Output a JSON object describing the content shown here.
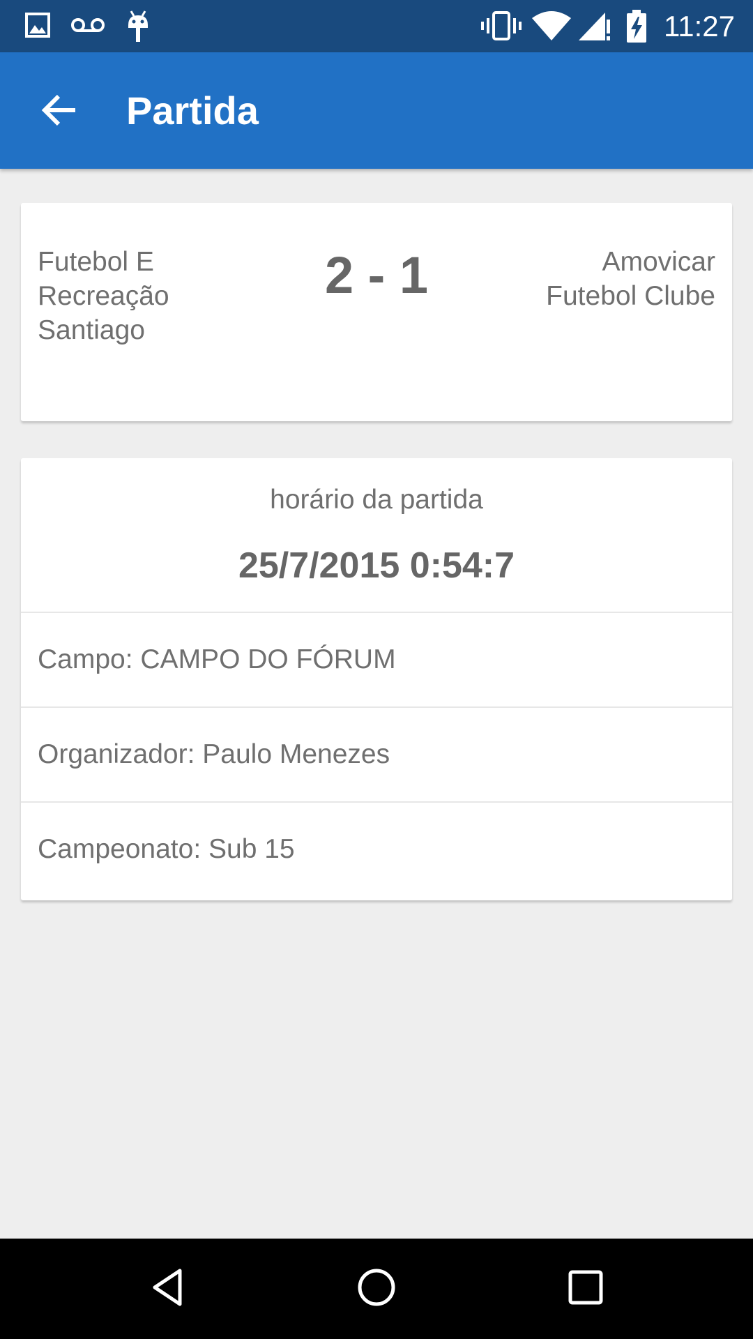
{
  "status_bar": {
    "time": "11:27",
    "left_icons": [
      "gallery-icon",
      "voicemail-icon",
      "android-debug-icon"
    ],
    "right_icons": [
      "vibrate-icon",
      "wifi-icon",
      "signal-icon",
      "battery-charging-icon"
    ]
  },
  "app_bar": {
    "title": "Partida",
    "back_icon": "arrow-back-icon",
    "color": "#2171c5"
  },
  "match": {
    "home_team": "Futebol E Recreação Santiago",
    "away_team": "Amovicar Futebol Clube",
    "score": "2 - 1"
  },
  "details": {
    "time_label": "horário da partida",
    "time_value": "25/7/2015 0:54:7",
    "field": "Campo: CAMPO DO FÓRUM",
    "organizer": "Organizador: Paulo Menezes",
    "championship": "Campeonato: Sub 15"
  },
  "nav_bar": {
    "buttons": [
      "back-triangle-icon",
      "home-circle-icon",
      "recent-apps-square-icon"
    ]
  }
}
